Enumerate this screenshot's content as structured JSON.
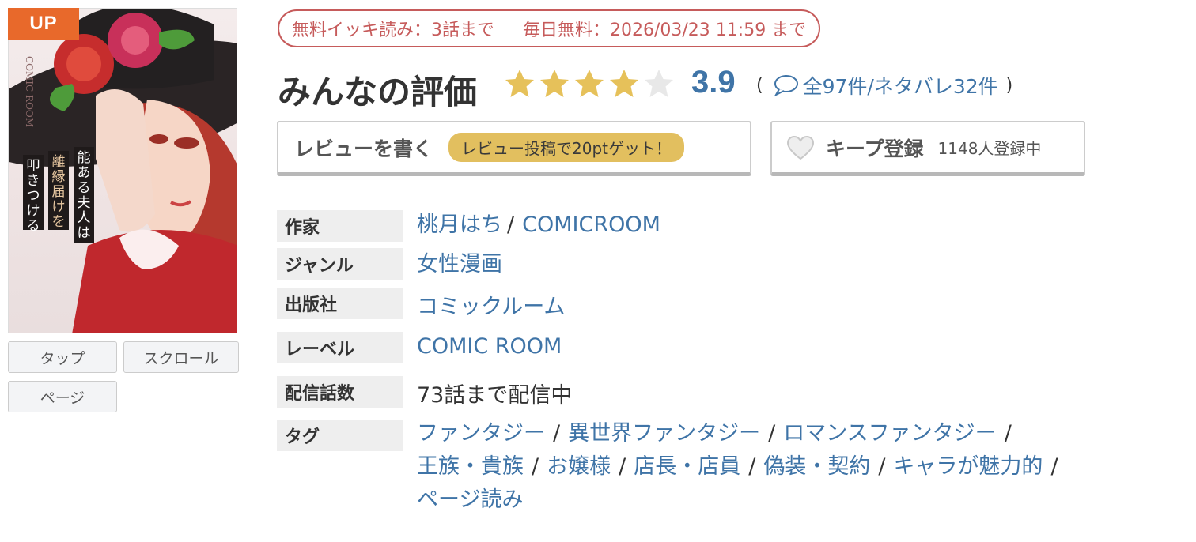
{
  "cover": {
    "badge": "UP",
    "art_text_lines": [
      "能ある夫人は",
      "離縁届けを",
      "叩きつける"
    ],
    "art_brand": "COMIC ROOM"
  },
  "view_buttons": [
    "タップ",
    "スクロール",
    "ページ"
  ],
  "free_banner": {
    "binge": "無料イッキ読み：3話まで",
    "daily": "毎日無料：2026/03/23 11:59 まで"
  },
  "rating": {
    "title": "みんなの評価",
    "score": "3.9",
    "score_value": 3.9,
    "stars_max": 5,
    "open_paren": "(",
    "close_paren": ")",
    "count_text": "全97件/ネタバレ32件",
    "icon": "speech-bubble-icon",
    "star_color": "#e6c15a",
    "star_empty_color": "#e8e8e8"
  },
  "review_button": {
    "label": "レビューを書く",
    "promo": "レビュー投稿で20ptゲット！"
  },
  "keep_button": {
    "icon": "heart-icon",
    "label": "キープ登録",
    "count": "1148人登録中"
  },
  "info": {
    "author_label": "作家",
    "authors": [
      "桃月はち",
      "COMICROOM"
    ],
    "genre_label": "ジャンル",
    "genre": "女性漫画",
    "publisher_label": "出版社",
    "publisher": "コミックルーム",
    "label_label": "レーベル",
    "label": "COMIC ROOM",
    "episodes_label": "配信話数",
    "episodes": "73話まで配信中",
    "tags_label": "タグ",
    "tags": [
      "ファンタジー",
      "異世界ファンタジー",
      "ロマンスファンタジー",
      "王族・貴族",
      "お嬢様",
      "店長・店員",
      "偽装・契約",
      "キャラが魅力的",
      "ページ読み"
    ]
  },
  "colors": {
    "link": "#3f74a7",
    "badge": "#e8692b",
    "banner": "#c65b5b",
    "promo_pill": "#e2bf5f"
  }
}
